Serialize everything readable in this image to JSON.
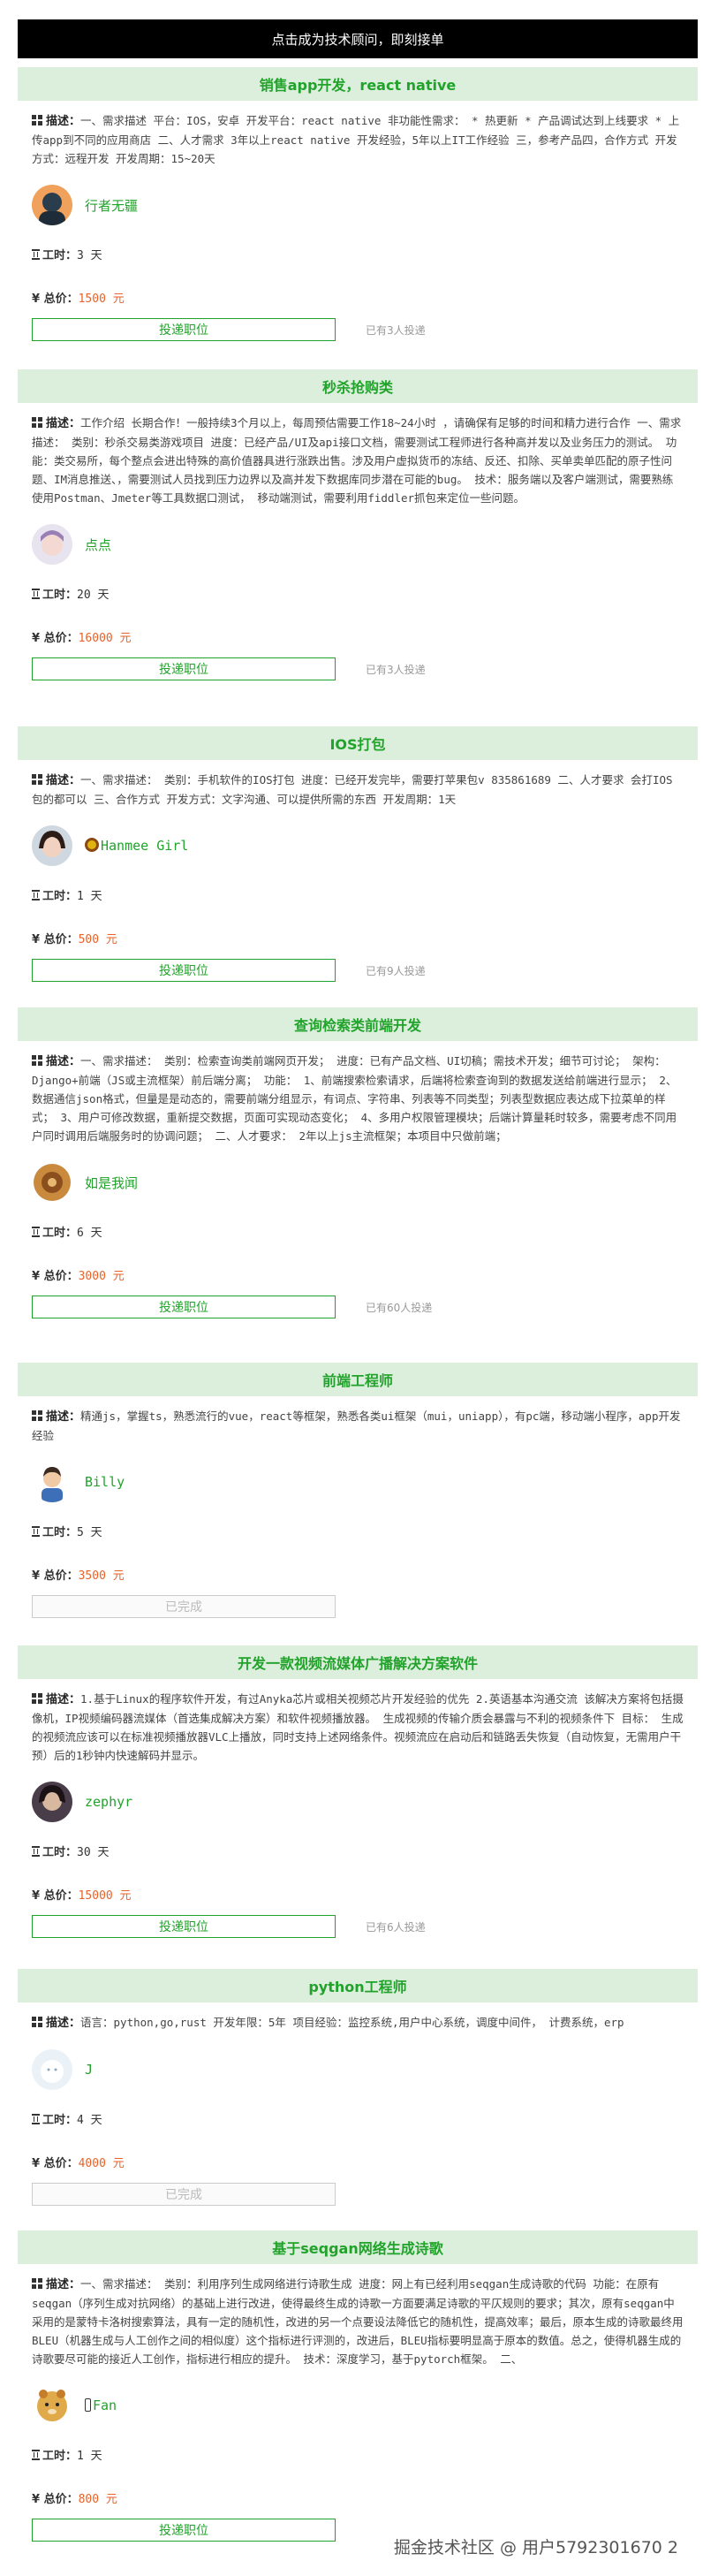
{
  "top_bar": {
    "text": "点击成为技术顾问，即刻接单"
  },
  "labels": {
    "desc": "描述：",
    "hours": "工时：",
    "total": "总价："
  },
  "cards": [
    {
      "title": "销售app开发，react native",
      "desc": "一、需求描述 平台：IOS，安卓 开发平台：react native 非功能性需求： * 热更新 * 产品调试达到上线要求 * 上传app到不同的应用商店 二、人才需求 3年以上react native 开发经验，5年以上IT工作经验 三，参考产品四，合作方式 开发方式：远程开发 开发周期：15~20天",
      "user": "行者无疆",
      "hours": "3 天",
      "price": "1500 元",
      "button": "投递职位",
      "count": "已有3人投递"
    },
    {
      "title": "秒杀抢购类",
      "desc": "工作介绍 长期合作！一般持续3个月以上，每周预估需要工作18~24小时 ，请确保有足够的时间和精力进行合作 一、需求描述： 类别：秒杀交易类游戏项目 进度：已经产品/UI及api接口文档，需要测试工程师进行各种高并发以及业务压力的测试。 功能：类交易所，每个整点会进出特殊的高价值器具进行涨跌出售。涉及用户虚拟货币的冻结、反还、扣除、买单卖单匹配的原子性问题、IM消息推送、，需要测试人员找到压力边界以及高并发下数据库同步潜在可能的bug。 技术：服务端以及客户端测试，需要熟练使用Postman、Jmeter等工具数据口测试， 移动端测试，需要利用fiddler抓包来定位一些问题。",
      "user": "点点",
      "hours": "20 天",
      "price": "16000 元",
      "button": "投递职位",
      "count": "已有3人投递"
    },
    {
      "title": "IOS打包",
      "desc": "一、需求描述： 类别：手机软件的IOS打包 进度：已经开发完毕，需要打苹果包v 835861689 二、人才要求 会打IOS包的都可以 三、合作方式 开发方式：文字沟通、可以提供所需的东西 开发周期：1天",
      "user": "Hanmee Girl",
      "hours": "1 天",
      "price": "500 元",
      "button": "投递职位",
      "count": "已有9人投递"
    },
    {
      "title": "查询检索类前端开发",
      "desc": "一、需求描述： 类别：检索查询类前端网页开发； 进度：已有产品文档、UI切稿；需技术开发；细节可讨论； 架构：Django+前端（JS或主流框架）前后端分离； 功能： 1、前端搜索检索请求，后端将检索查询到的数据发送给前端进行显示； 2、数据通信json格式，但量是是动态的，需要前端分组显示，有词点、字符串、列表等不同类型；列表型数据应表达成下拉菜单的样式； 3、用户可修改数据，重新提交数据，页面可实现动态变化； 4、多用户权限管理模块；后端计算量耗时较多，需要考虑不同用户同时调用后端服务时的协调问题； 二、人才要求： 2年以上js主流框架；本项目中只做前端；",
      "user": "如是我闻",
      "hours": "6 天",
      "price": "3000 元",
      "button": "投递职位",
      "count": "已有60人投递"
    },
    {
      "title": "前端工程师",
      "desc": "精通js，掌握ts，熟悉流行的vue，react等框架，熟悉各类ui框架（mui，uniapp），有pc端，移动端小程序，app开发经验",
      "user": "Billy",
      "hours": "5 天",
      "price": "3500 元",
      "button": "已完成",
      "count": ""
    },
    {
      "title": "开发一款视频流媒体广播解决方案软件",
      "desc": "1.基于Linux的程序软件开发，有过Anyka芯片或相关视频芯片开发经验的优先 2.英语基本沟通交流 该解决方案将包括摄像机，IP视频编码器流媒体（首选集成解决方案）和软件视频播放器。 生成视频的传输介质会暴露与不利的视频条件下 目标： 生成的视频流应该可以在标准视频播放器VLC上播放，同时支持上述网络条件。视频流应在启动后和链路丢失恢复（自动恢复，无需用户干预）后的1秒钟内快速解码并显示。",
      "user": "zephyr",
      "hours": "30 天",
      "price": "15000 元",
      "button": "投递职位",
      "count": "已有6人投递"
    },
    {
      "title": "python工程师",
      "desc": "语言：python,go,rust 开发年限：5年 项目经验：监控系统,用户中心系统，调度中间件， 计费系统，erp",
      "user": "J",
      "hours": "4 天",
      "price": "4000 元",
      "button": "已完成",
      "count": ""
    },
    {
      "title": "基于seqgan网络生成诗歌",
      "desc": "一、需求描述： 类别：利用序列生成网络进行诗歌生成 进度：网上有已经利用seqgan生成诗歌的代码 功能：在原有seqgan（序列生成对抗网络）的基础上进行改进，使得最终生成的诗歌一方面要满足诗歌的平仄规则的要求；其次，原有seqgan中采用的是蒙特卡洛树搜索算法，具有一定的随机性，改进的另一个点要设法降低它的随机性，提高效率；最后，原本生成的诗歌最终用BLEU（机器生成与人工创作之间的相似度）这个指标进行评测的，改进后，BLEU指标要明显高于原本的数值。总之，使得机器生成的诗歌要尽可能的接近人工创作，指标进行相应的提升。 技术：深度学习，基于pytorch框架。 二、",
      "user": "Fan",
      "hours": "1 天",
      "price": "800 元",
      "button": "投递职位",
      "count": ""
    }
  ],
  "watermark": "掘金技术社区 @ 用户5792301670 2",
  "colors": {
    "accent": "#21a32b",
    "header_bg": "#dcefdc",
    "price": "#e8622a",
    "top_bar": "#000000"
  }
}
